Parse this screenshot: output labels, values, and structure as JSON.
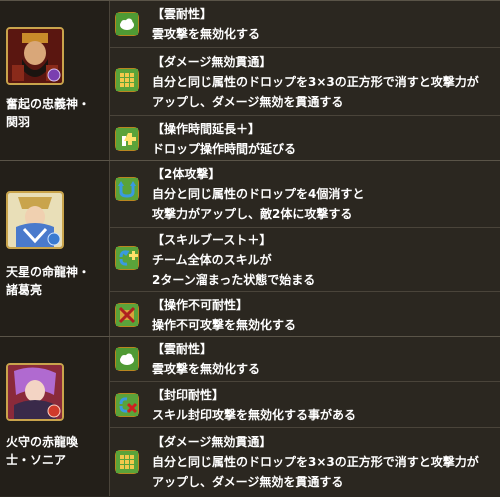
{
  "characters": [
    {
      "name_line1": "奮起の忠義神・",
      "name_line2": "関羽",
      "awakenings": [
        {
          "icon": "cloud-resist-icon",
          "title": "【雲耐性】",
          "desc": [
            "雲攻撃を無効化する"
          ]
        },
        {
          "icon": "void-penetration-icon",
          "title": "【ダメージ無効貫通】",
          "desc": [
            "自分と同じ属性のドロップを3×3の正方形で消すと攻撃力が",
            "アップし、ダメージ無効を貫通する"
          ]
        },
        {
          "icon": "time-extend-plus-icon",
          "title": "【操作時間延長＋】",
          "desc": [
            "ドロップ操作時間が延びる"
          ]
        }
      ]
    },
    {
      "name_line1": "天星の命龍神・",
      "name_line2": "諸葛亮",
      "awakenings": [
        {
          "icon": "two-pronged-attack-icon",
          "title": "【2体攻撃】",
          "desc": [
            "自分と同じ属性のドロップを4個消すと",
            "攻撃力がアップし、敵2体に攻撃する"
          ]
        },
        {
          "icon": "skill-boost-plus-icon",
          "title": "【スキルブースト＋】",
          "desc": [
            "チーム全体のスキルが",
            "2ターン溜まった状態で始まる"
          ]
        },
        {
          "icon": "unmovable-resist-icon",
          "title": "【操作不可耐性】",
          "desc": [
            "操作不可攻撃を無効化する"
          ]
        }
      ]
    },
    {
      "name_line1": "火守の赤龍喚",
      "name_line2": "士・ソニア",
      "awakenings": [
        {
          "icon": "cloud-resist-icon",
          "title": "【雲耐性】",
          "desc": [
            "雲攻撃を無効化する"
          ]
        },
        {
          "icon": "skill-bind-resist-icon",
          "title": "【封印耐性】",
          "desc": [
            "スキル封印攻撃を無効化する事がある"
          ]
        },
        {
          "icon": "void-penetration-icon",
          "title": "【ダメージ無効貫通】",
          "desc": [
            "自分と同じ属性のドロップを3×3の正方形で消すと攻撃力が",
            "アップし、ダメージ無効を貫通する"
          ]
        }
      ]
    }
  ]
}
